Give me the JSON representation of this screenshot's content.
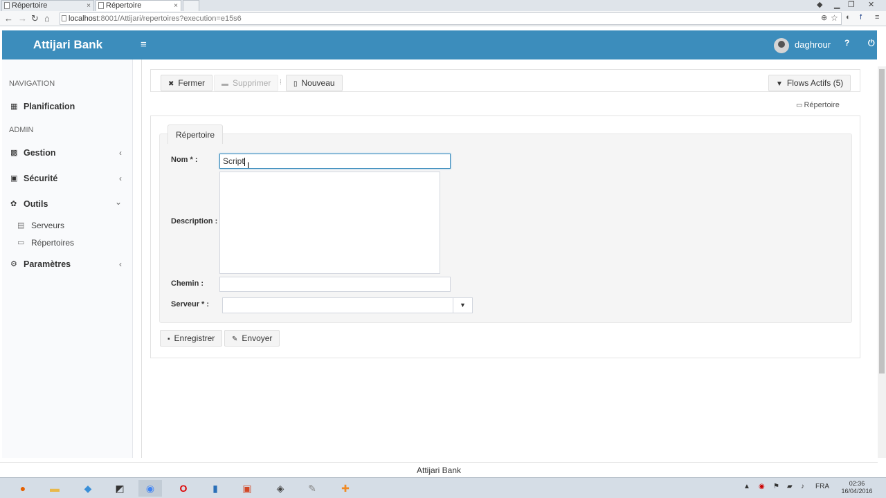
{
  "browser": {
    "tabs": [
      {
        "label": "Répertoire",
        "close": "×"
      },
      {
        "label": "Répertoire",
        "close": "×"
      }
    ],
    "url_host": "localhost",
    "url_rest": ":8001/Attijari/repertoires?execution=e15s6"
  },
  "header": {
    "brand": "Attijari Bank",
    "toggle_icon": "≡",
    "username": "daghrour",
    "help_icon": "?",
    "power_icon": "⏻"
  },
  "sidebar": {
    "nav_heading": "NAVIGATION",
    "admin_heading": "ADMIN",
    "planification": "Planification",
    "gestion": "Gestion",
    "securite": "Sécurité",
    "outils": "Outils",
    "serveurs": "Serveurs",
    "repertoires": "Répertoires",
    "parametres": "Paramètres",
    "chevron_left": "‹",
    "chevron_down": "⌄"
  },
  "toolbar": {
    "fermer": "Fermer",
    "supprimer": "Supprimer",
    "nouveau": "Nouveau",
    "flows": "Flows Actifs (5)"
  },
  "breadcrumb": {
    "label": "Répertoire"
  },
  "form": {
    "legend": "Répertoire",
    "nom_label": "Nom * :",
    "nom_value": "Script",
    "description_label": "Description :",
    "description_value": "",
    "chemin_label": "Chemin :",
    "chemin_value": "",
    "serveur_label": "Serveur * :",
    "serveur_value": ""
  },
  "actions": {
    "enregistrer": "Enregistrer",
    "envoyer": "Envoyer"
  },
  "footer": {
    "text": "Attijari Bank"
  },
  "taskbar": {
    "lang": "FRA",
    "time": "02:36",
    "date": "16/04/2016"
  }
}
